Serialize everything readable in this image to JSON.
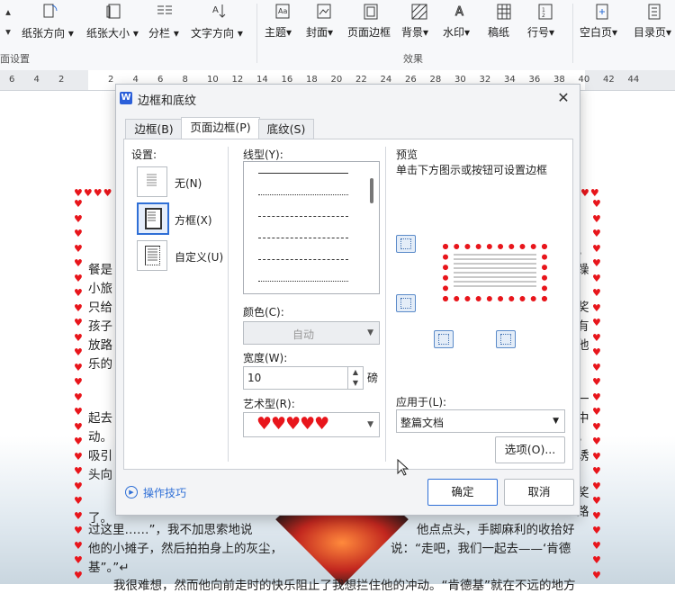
{
  "ribbon": {
    "items": [
      {
        "label": "纸张方向",
        "icon": "orientation-icon"
      },
      {
        "label": "纸张大小",
        "icon": "paper-size-icon"
      },
      {
        "label": "分栏",
        "icon": "columns-icon"
      },
      {
        "label": "文字方向",
        "icon": "text-direction-icon"
      },
      {
        "label": "主题",
        "icon": "theme-icon"
      },
      {
        "label": "封面",
        "icon": "cover-icon"
      },
      {
        "label": "页面边框",
        "icon": "page-border-icon"
      },
      {
        "label": "背景",
        "icon": "background-icon"
      },
      {
        "label": "水印",
        "icon": "watermark-icon"
      },
      {
        "label": "稿纸",
        "icon": "draft-paper-icon"
      },
      {
        "label": "行号",
        "icon": "line-number-icon"
      },
      {
        "label": "空白页",
        "icon": "blank-page-icon"
      },
      {
        "label": "目录页",
        "icon": "toc-page-icon"
      }
    ],
    "group_page_setup": "面设置",
    "group_effects": "效果"
  },
  "ruler": {
    "marks": [
      "6",
      "4",
      "2",
      "",
      "2",
      "4",
      "6",
      "8",
      "10",
      "12",
      "14",
      "16",
      "18",
      "20",
      "22",
      "24",
      "26",
      "28",
      "30",
      "32",
      "34",
      "36",
      "38",
      "40",
      "42",
      "44"
    ]
  },
  "document": {
    "lines": [
      "餐是",
      "小旅",
      "只给",
      "孩子",
      "放路",
      "乐的",
      "起去",
      "动。",
      "吸引",
      "头向",
      "了。",
      "过这里……”，我不加思索地说",
      "他的小摊子，然后拍拍身上的灰尘，",
      "基”。”↵",
      "他点点头，手脚麻利的收拾好",
      "说：“走吧，我们一起去——‘肯德",
      "我很难想，然而他向前走时的快乐阻止了我想拦住他的冲动。“肯德基”就在不远的地方"
    ],
    "right_chars": [
      "，",
      "躁",
      "奖",
      "有",
      "他",
      "一",
      "中",
      "，",
      "诱",
      "奖",
      "路"
    ]
  },
  "dialog": {
    "title": "边框和底纹",
    "close": "✕",
    "tabs": [
      "边框(B)",
      "页面边框(P)",
      "底纹(S)"
    ],
    "active_tab": 1,
    "settings_label": "设置:",
    "settings": [
      "无(N)",
      "方框(X)",
      "自定义(U)"
    ],
    "linetype_label": "线型(Y):",
    "color_label": "颜色(C):",
    "color_value": "自动",
    "width_label": "宽度(W):",
    "width_value": "10",
    "width_unit": "磅",
    "art_label": "艺术型(R):",
    "art_value": "♥♥♥♥♥",
    "preview_label": "预览",
    "preview_hint": "单击下方图示或按钮可设置边框",
    "apply_label": "应用于(L):",
    "apply_value": "整篇文档",
    "options_button": "选项(O)...",
    "tips_link": "操作技巧",
    "ok_button": "确定",
    "cancel_button": "取消"
  },
  "colors": {
    "accent": "#2f6fd6",
    "heart": "#e8151b"
  }
}
